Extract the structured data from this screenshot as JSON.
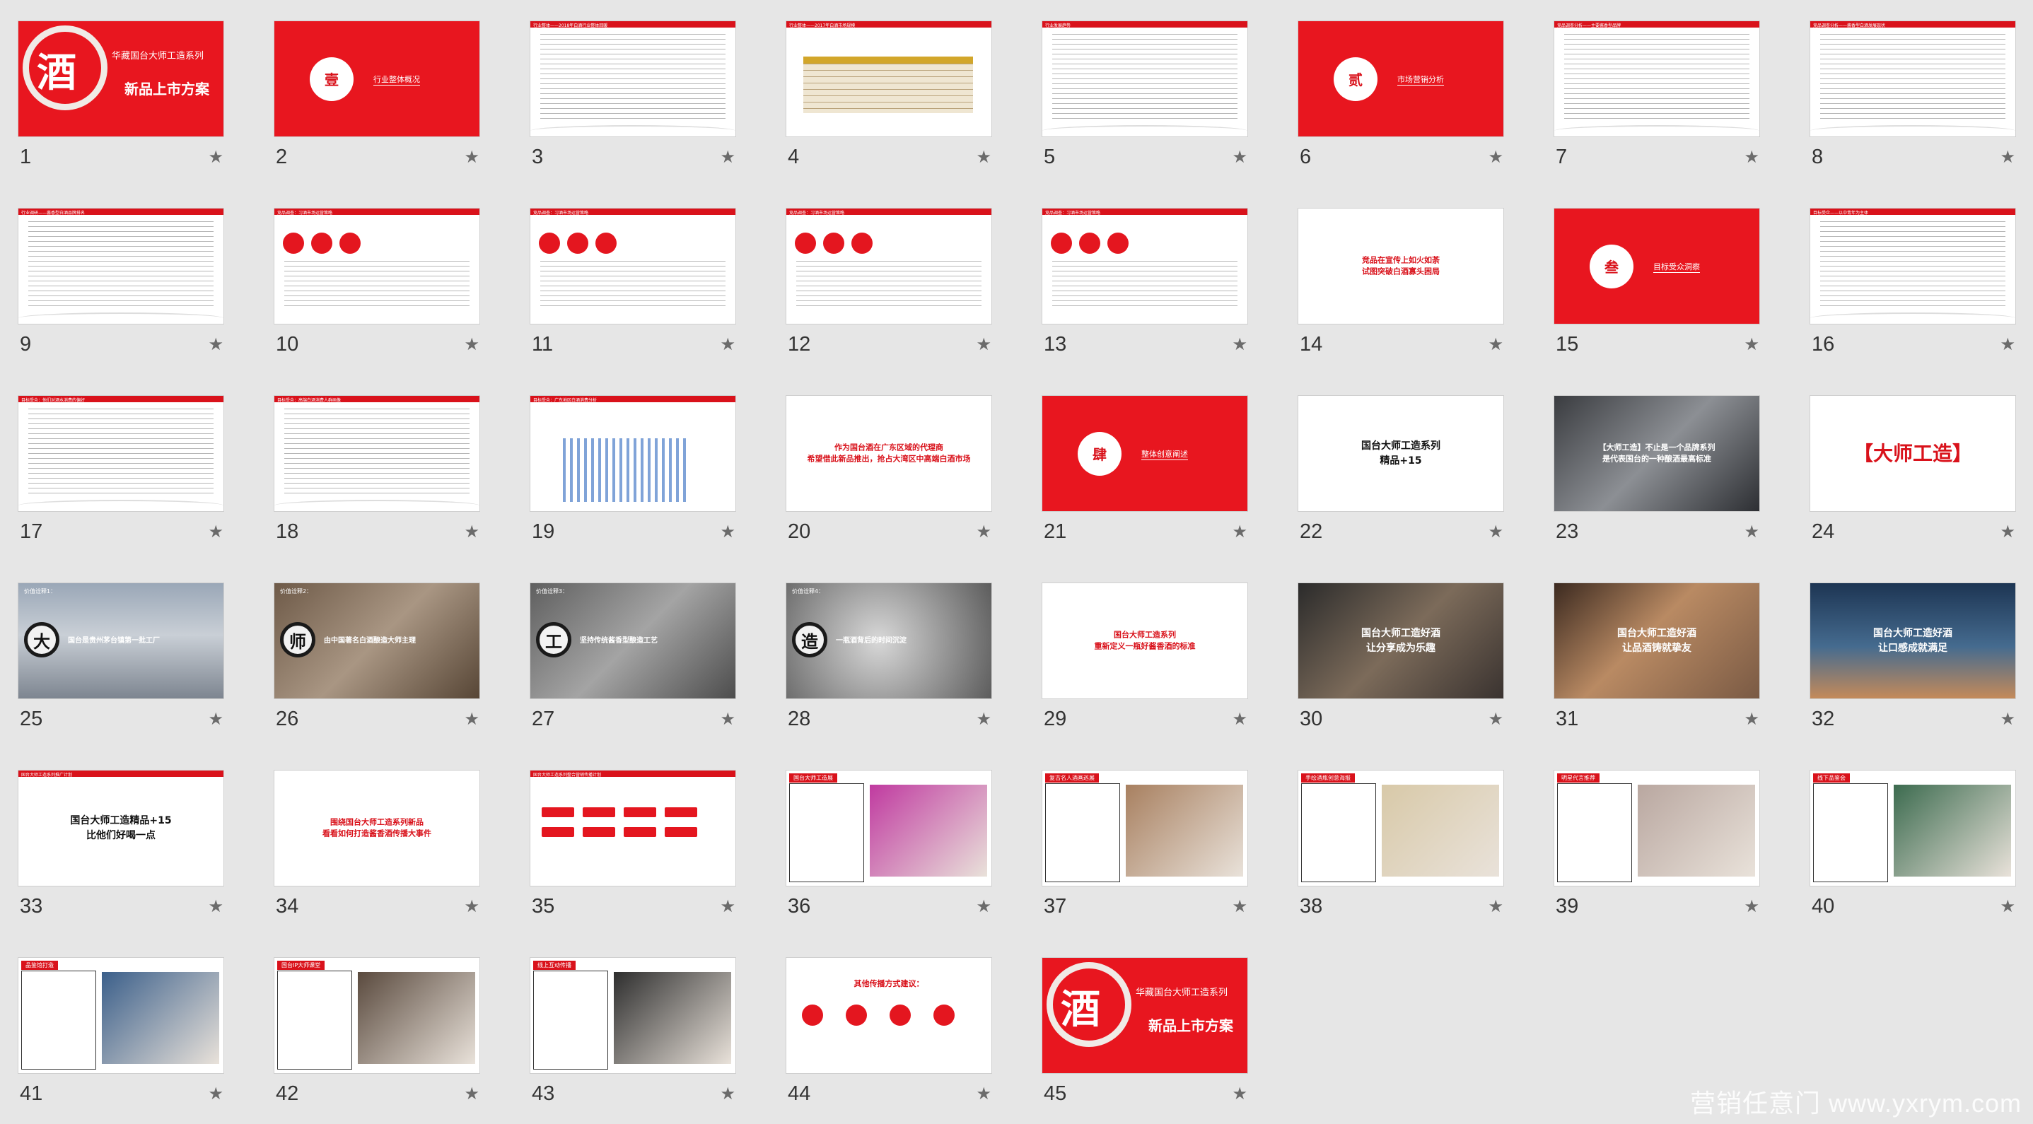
{
  "slides": [
    {
      "num": "1",
      "style": "cover",
      "char": "酒",
      "title": "华藏国台大师工造系列",
      "sub": "新品上市方案"
    },
    {
      "num": "2",
      "style": "section",
      "char": "壹",
      "title": "行业整体概况"
    },
    {
      "num": "3",
      "style": "text",
      "bar": "行业整体——2018年白酒行业整体回暖"
    },
    {
      "num": "4",
      "style": "table",
      "bar": "行业整体——2017年白酒市场规模"
    },
    {
      "num": "5",
      "style": "text",
      "bar": "行业发展趋势"
    },
    {
      "num": "6",
      "style": "section",
      "char": "贰",
      "title": "市场营销分析"
    },
    {
      "num": "7",
      "style": "text",
      "bar": "竞品调查分析——主要酱香型品牌"
    },
    {
      "num": "8",
      "style": "text",
      "bar": "竞品调查分析——酱香型白酒发展现状"
    },
    {
      "num": "9",
      "style": "text",
      "bar": "行业调研——酱香型白酒品牌排名"
    },
    {
      "num": "10",
      "style": "dots",
      "bar": "竞品调查：习酒市场运营策略"
    },
    {
      "num": "11",
      "style": "dots",
      "bar": "竞品调查：习酒市场运营策略"
    },
    {
      "num": "12",
      "style": "dots",
      "bar": "竞品调查：习酒市场运营策略"
    },
    {
      "num": "13",
      "style": "dots",
      "bar": "竞品调查：习酒市场运营策略"
    },
    {
      "num": "14",
      "style": "center-red",
      "text": "竞品在宣传上如火如荼\n试图突破白酒寡头困局"
    },
    {
      "num": "15",
      "style": "section",
      "char": "叁",
      "title": "目标受众洞察"
    },
    {
      "num": "16",
      "style": "text",
      "bar": "目标受众——以中青年为主体"
    },
    {
      "num": "17",
      "style": "text",
      "bar": "目标受众：他们对酒水消费的偏好"
    },
    {
      "num": "18",
      "style": "text",
      "bar": "目标受众：高端白酒消费人群画像"
    },
    {
      "num": "19",
      "style": "bars",
      "bar": "目标受众：广东地区白酒消费分析"
    },
    {
      "num": "20",
      "style": "center-red",
      "text": "作为国台酒在广东区域的代理商\n希望借此新品推出，抢占大湾区中高端白酒市场"
    },
    {
      "num": "21",
      "style": "section",
      "char": "肆",
      "title": "整体创意阐述"
    },
    {
      "num": "22",
      "style": "center-dark",
      "text": "国台大师工造系列\n精品+15"
    },
    {
      "num": "23",
      "style": "photo-man",
      "text": "【大师工造】不止是一个品牌系列\n是代表国台的一种酿酒最高标准"
    },
    {
      "num": "24",
      "style": "center-red-big",
      "text": "【大师工造】"
    },
    {
      "num": "25",
      "style": "value",
      "tone": "t-photo-blue",
      "label": "价值诠释1：",
      "char": "大",
      "text": "国台是贵州茅台镇第一批工厂"
    },
    {
      "num": "26",
      "style": "value",
      "tone": "t-photo-sepia",
      "label": "价值诠释2：",
      "char": "师",
      "text": "由中国著名白酒酿造大师主理"
    },
    {
      "num": "27",
      "style": "value",
      "tone": "t-photo-gray",
      "label": "价值诠释3：",
      "char": "工",
      "text": "坚持传统酱香型酿造工艺"
    },
    {
      "num": "28",
      "style": "value",
      "tone": "t-photo-clock",
      "label": "价值诠释4：",
      "char": "造",
      "text": "一瓶酒背后的时间沉淀"
    },
    {
      "num": "29",
      "style": "center-red",
      "text": "国台大师工造系列\n重新定义一瓶好酱香酒的标准"
    },
    {
      "num": "30",
      "style": "photo-text",
      "tone": "t-photo-dark",
      "text": "国台大师工造好酒\n让分享成为乐趣"
    },
    {
      "num": "31",
      "style": "photo-text",
      "tone": "t-photo-warm",
      "text": "国台大师工造好酒\n让品酒铸就挚友"
    },
    {
      "num": "32",
      "style": "photo-text",
      "tone": "t-photo-night",
      "text": "国台大师工造好酒\n让口感成就满足"
    },
    {
      "num": "33",
      "style": "center-dark-bar",
      "bar": "国台大师工造系列推广计划",
      "text": "国台大师工造精品+15\n比他们好喝一点"
    },
    {
      "num": "34",
      "style": "center-red",
      "text": "围绕国台大师工造系列新品\n看看如何打造酱香酒传播大事件"
    },
    {
      "num": "35",
      "style": "buttons",
      "bar": "国台大师工造系列整合营销传播计划"
    },
    {
      "num": "36",
      "style": "panel",
      "tag": "国台大师工造展",
      "img": "#c03aa0"
    },
    {
      "num": "37",
      "style": "panel",
      "tag": "复古名人酒画巡展",
      "img": "#a88060"
    },
    {
      "num": "38",
      "style": "panel",
      "tag": "手绘酒瓶创意海报",
      "img": "#d8c9a8"
    },
    {
      "num": "39",
      "style": "panel",
      "tag": "明星代言推荐",
      "img": "#b9a7a0"
    },
    {
      "num": "40",
      "style": "panel",
      "tag": "线下品鉴会",
      "img": "#3c6b4f"
    },
    {
      "num": "41",
      "style": "panel",
      "tag": "品鉴馆打造",
      "img": "#3b5f8a"
    },
    {
      "num": "42",
      "style": "panel",
      "tag": "国台IP大师课堂",
      "img": "#5a4a3e"
    },
    {
      "num": "43",
      "style": "panel",
      "tag": "线上互动传播",
      "img": "#2e2e2e"
    },
    {
      "num": "44",
      "style": "dots-center",
      "text": "其他传播方式建议："
    },
    {
      "num": "45",
      "style": "cover",
      "char": "酒",
      "title": "华藏国台大师工造系列",
      "sub": "新品上市方案"
    }
  ],
  "star_glyph": "★",
  "watermark": "营销任意门 www.yxrym.com",
  "colors": {
    "brand_red": "#e8161f",
    "background": "#e6e6e6"
  }
}
